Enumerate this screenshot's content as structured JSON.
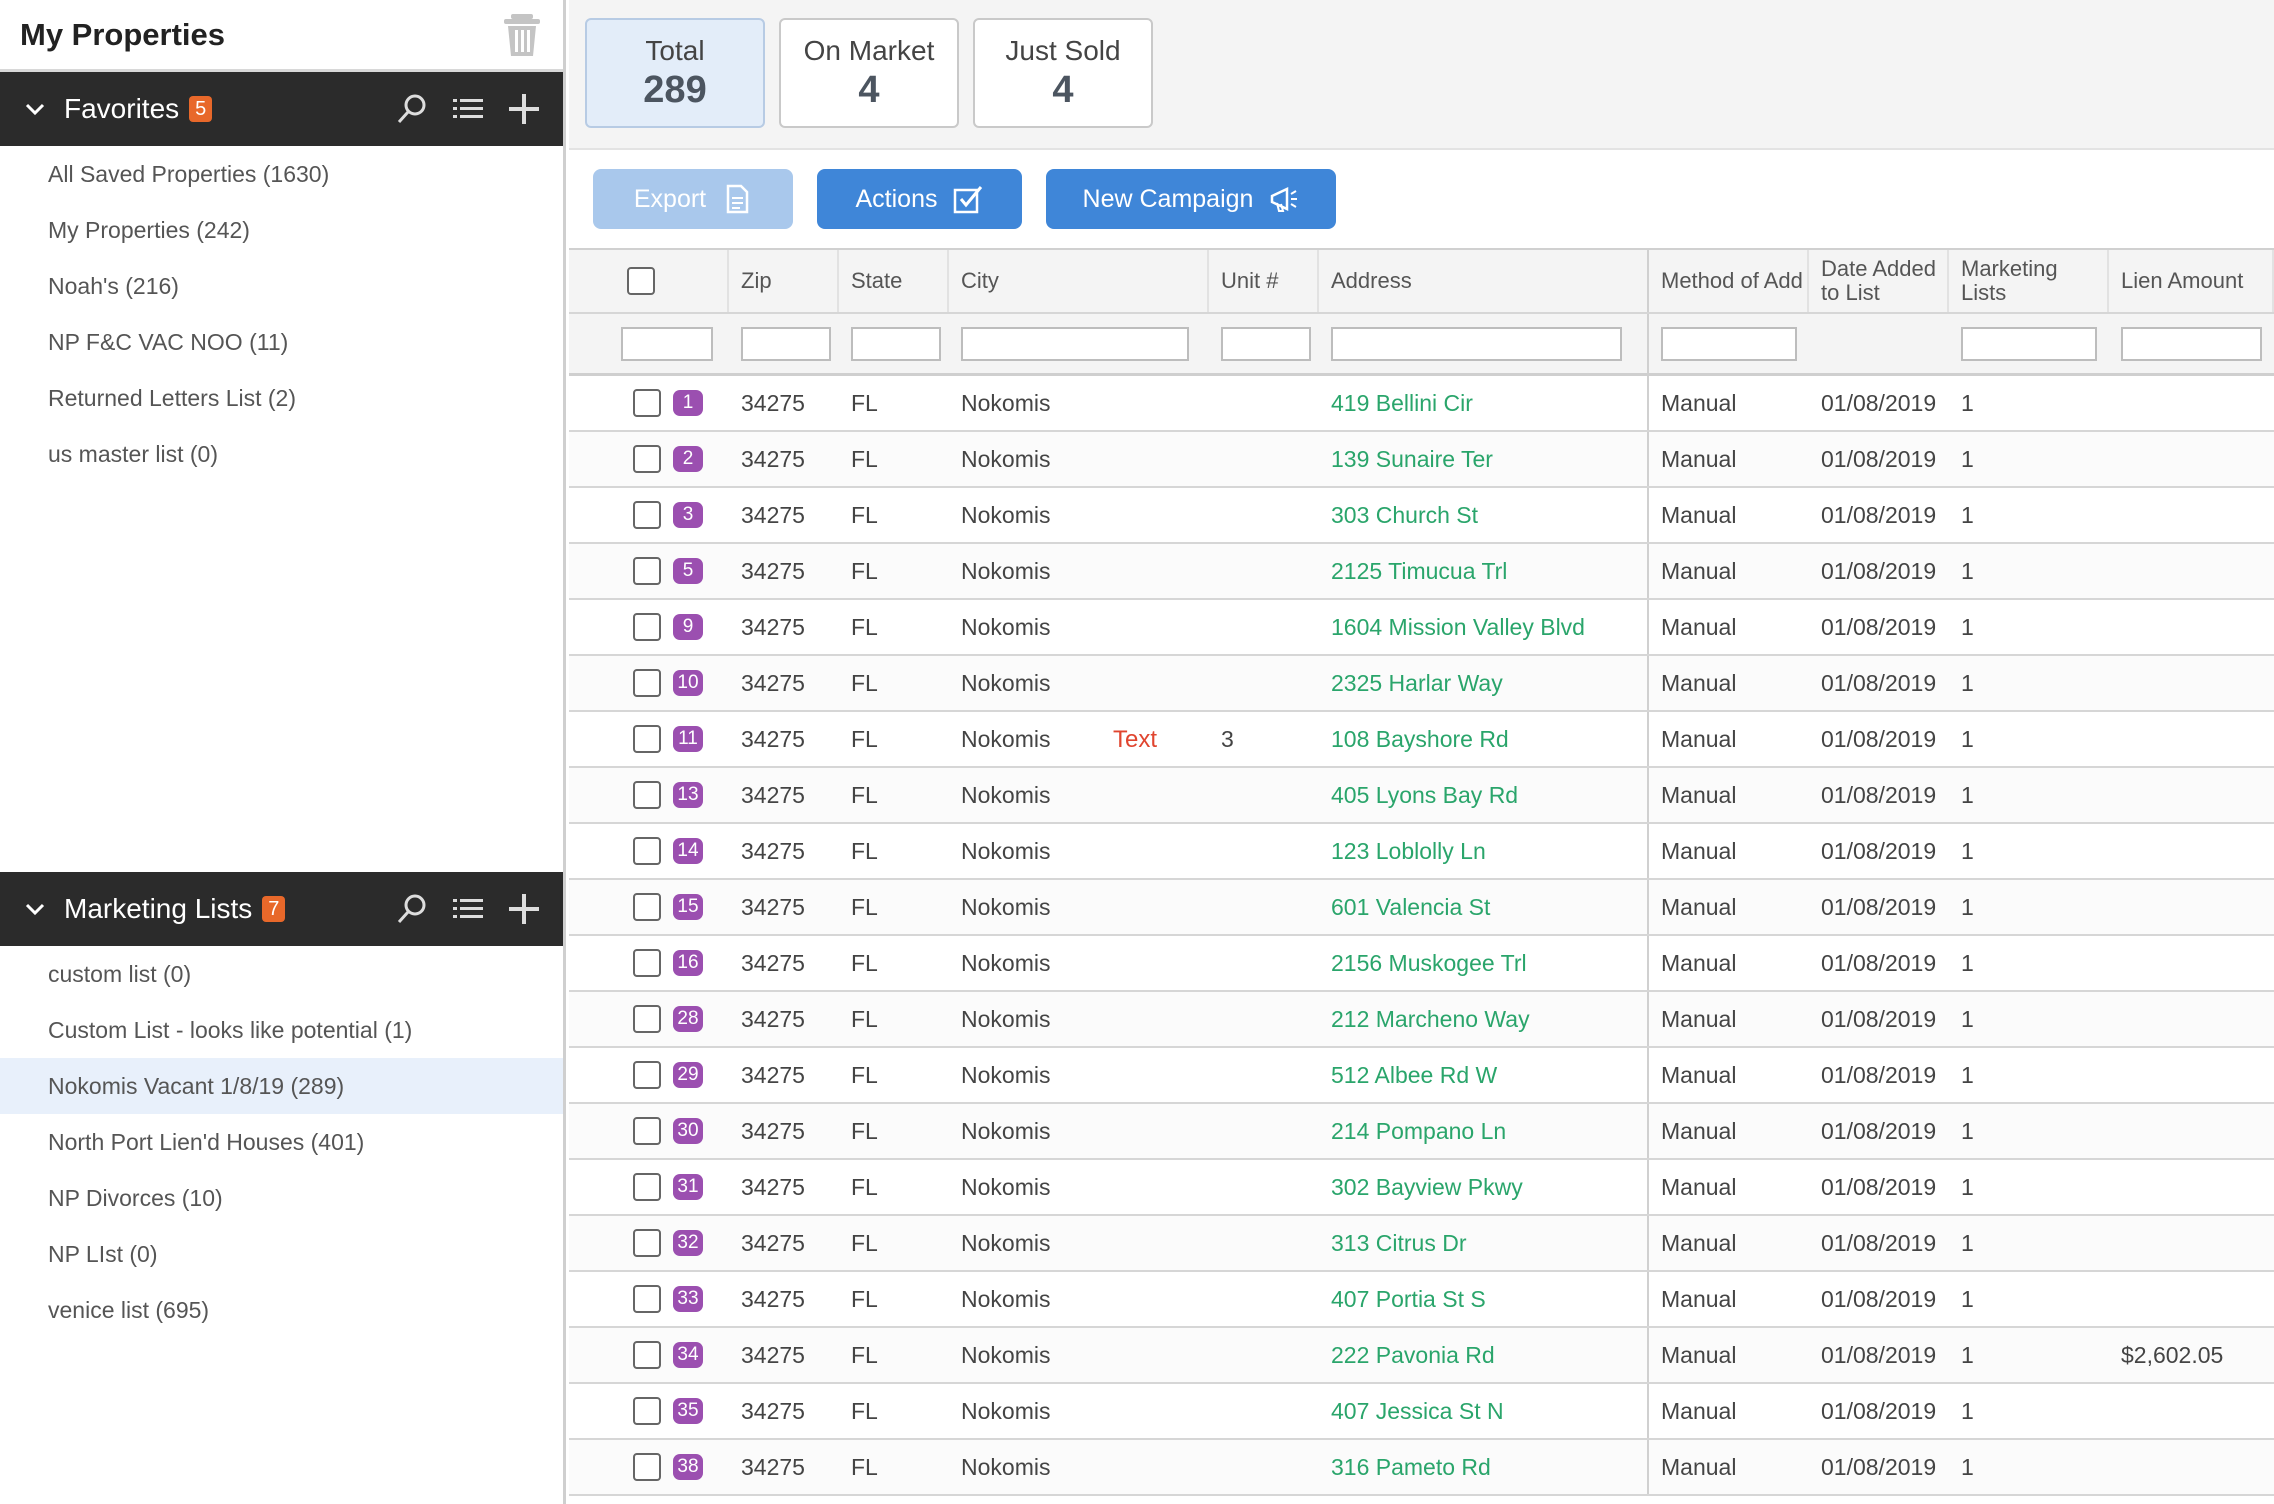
{
  "sidebar": {
    "title": "My Properties",
    "favorites": {
      "label": "Favorites",
      "count": "5",
      "items": [
        "All Saved Properties (1630)",
        "My Properties (242)",
        "Noah's (216)",
        "NP F&C VAC NOO (11)",
        "Returned Letters List (2)",
        "us master list (0)"
      ]
    },
    "marketing": {
      "label": "Marketing Lists",
      "count": "7",
      "items": [
        "custom list (0)",
        "Custom List - looks like potential (1)",
        "Nokomis Vacant 1/8/19 (289)",
        "North Port Lien'd Houses (401)",
        "NP Divorces (10)",
        "NP LIst (0)",
        "venice list (695)"
      ],
      "active_index": 2
    }
  },
  "stats": [
    {
      "label": "Total",
      "value": "289",
      "selected": true
    },
    {
      "label": "On Market",
      "value": "4",
      "selected": false
    },
    {
      "label": "Just Sold",
      "value": "4",
      "selected": false
    }
  ],
  "toolbar": {
    "export_label": "Export",
    "actions_label": "Actions",
    "campaign_label": "New Campaign"
  },
  "grid": {
    "headers": {
      "zip": "Zip",
      "state": "State",
      "city": "City",
      "unit": "Unit #",
      "address": "Address",
      "method": "Method of Add",
      "date": "Date Added to List",
      "mlists": "Marketing Lists",
      "lien": "Lien Amount"
    },
    "annotation": "Text",
    "rows": [
      {
        "n": "1",
        "zip": "34275",
        "state": "FL",
        "city": "Nokomis",
        "unit": "",
        "address": "419 Bellini Cir",
        "method": "Manual",
        "date": "01/08/2019",
        "mlists": "1",
        "lien": ""
      },
      {
        "n": "2",
        "zip": "34275",
        "state": "FL",
        "city": "Nokomis",
        "unit": "",
        "address": "139 Sunaire Ter",
        "method": "Manual",
        "date": "01/08/2019",
        "mlists": "1",
        "lien": ""
      },
      {
        "n": "3",
        "zip": "34275",
        "state": "FL",
        "city": "Nokomis",
        "unit": "",
        "address": "303 Church St",
        "method": "Manual",
        "date": "01/08/2019",
        "mlists": "1",
        "lien": ""
      },
      {
        "n": "5",
        "zip": "34275",
        "state": "FL",
        "city": "Nokomis",
        "unit": "",
        "address": "2125 Timucua Trl",
        "method": "Manual",
        "date": "01/08/2019",
        "mlists": "1",
        "lien": ""
      },
      {
        "n": "9",
        "zip": "34275",
        "state": "FL",
        "city": "Nokomis",
        "unit": "",
        "address": "1604 Mission Valley Blvd",
        "method": "Manual",
        "date": "01/08/2019",
        "mlists": "1",
        "lien": ""
      },
      {
        "n": "10",
        "zip": "34275",
        "state": "FL",
        "city": "Nokomis",
        "unit": "",
        "address": "2325 Harlar Way",
        "method": "Manual",
        "date": "01/08/2019",
        "mlists": "1",
        "lien": ""
      },
      {
        "n": "11",
        "zip": "34275",
        "state": "FL",
        "city": "Nokomis",
        "unit": "3",
        "address": "108 Bayshore Rd",
        "method": "Manual",
        "date": "01/08/2019",
        "mlists": "1",
        "lien": ""
      },
      {
        "n": "13",
        "zip": "34275",
        "state": "FL",
        "city": "Nokomis",
        "unit": "",
        "address": "405 Lyons Bay Rd",
        "method": "Manual",
        "date": "01/08/2019",
        "mlists": "1",
        "lien": ""
      },
      {
        "n": "14",
        "zip": "34275",
        "state": "FL",
        "city": "Nokomis",
        "unit": "",
        "address": "123 Loblolly Ln",
        "method": "Manual",
        "date": "01/08/2019",
        "mlists": "1",
        "lien": ""
      },
      {
        "n": "15",
        "zip": "34275",
        "state": "FL",
        "city": "Nokomis",
        "unit": "",
        "address": "601 Valencia St",
        "method": "Manual",
        "date": "01/08/2019",
        "mlists": "1",
        "lien": ""
      },
      {
        "n": "16",
        "zip": "34275",
        "state": "FL",
        "city": "Nokomis",
        "unit": "",
        "address": "2156 Muskogee Trl",
        "method": "Manual",
        "date": "01/08/2019",
        "mlists": "1",
        "lien": ""
      },
      {
        "n": "28",
        "zip": "34275",
        "state": "FL",
        "city": "Nokomis",
        "unit": "",
        "address": "212 Marcheno Way",
        "method": "Manual",
        "date": "01/08/2019",
        "mlists": "1",
        "lien": ""
      },
      {
        "n": "29",
        "zip": "34275",
        "state": "FL",
        "city": "Nokomis",
        "unit": "",
        "address": "512 Albee Rd W",
        "method": "Manual",
        "date": "01/08/2019",
        "mlists": "1",
        "lien": ""
      },
      {
        "n": "30",
        "zip": "34275",
        "state": "FL",
        "city": "Nokomis",
        "unit": "",
        "address": "214 Pompano Ln",
        "method": "Manual",
        "date": "01/08/2019",
        "mlists": "1",
        "lien": ""
      },
      {
        "n": "31",
        "zip": "34275",
        "state": "FL",
        "city": "Nokomis",
        "unit": "",
        "address": "302 Bayview Pkwy",
        "method": "Manual",
        "date": "01/08/2019",
        "mlists": "1",
        "lien": ""
      },
      {
        "n": "32",
        "zip": "34275",
        "state": "FL",
        "city": "Nokomis",
        "unit": "",
        "address": "313 Citrus Dr",
        "method": "Manual",
        "date": "01/08/2019",
        "mlists": "1",
        "lien": ""
      },
      {
        "n": "33",
        "zip": "34275",
        "state": "FL",
        "city": "Nokomis",
        "unit": "",
        "address": "407 Portia St S",
        "method": "Manual",
        "date": "01/08/2019",
        "mlists": "1",
        "lien": ""
      },
      {
        "n": "34",
        "zip": "34275",
        "state": "FL",
        "city": "Nokomis",
        "unit": "",
        "address": "222 Pavonia Rd",
        "method": "Manual",
        "date": "01/08/2019",
        "mlists": "1",
        "lien": "$2,602.05"
      },
      {
        "n": "35",
        "zip": "34275",
        "state": "FL",
        "city": "Nokomis",
        "unit": "",
        "address": "407 Jessica St N",
        "method": "Manual",
        "date": "01/08/2019",
        "mlists": "1",
        "lien": ""
      },
      {
        "n": "38",
        "zip": "34275",
        "state": "FL",
        "city": "Nokomis",
        "unit": "",
        "address": "316 Pameto Rd",
        "method": "Manual",
        "date": "01/08/2019",
        "mlists": "1",
        "lien": ""
      }
    ]
  },
  "colors": {
    "accent": "#3f86d8",
    "badge": "#e8682a",
    "row_number": "#9b4fb0",
    "address_link": "#2aa56b",
    "annotation": "#e0452f"
  }
}
